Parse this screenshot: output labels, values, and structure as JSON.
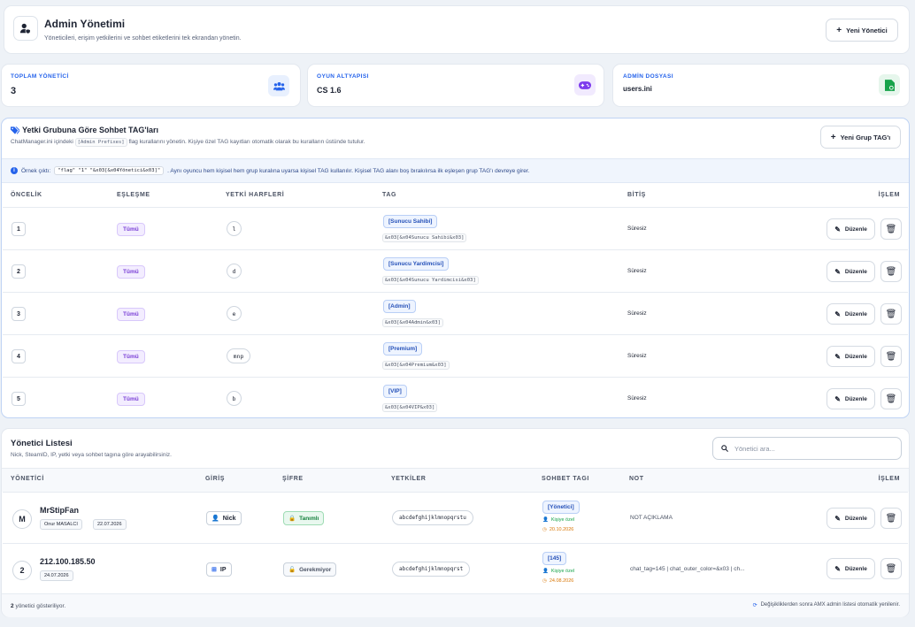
{
  "header": {
    "title": "Admin Yönetimi",
    "subtitle": "Yöneticileri, erişim yetkilerini ve sohbet etiketlerini tek ekrandan yönetin.",
    "new_button": "Yeni Yönetici"
  },
  "stats": [
    {
      "label": "TOPLAM YÖNETİCİ",
      "value": "3",
      "icon": "users-icon",
      "color": "#2563eb"
    },
    {
      "label": "OYUN ALTYAPISI",
      "value": "CS 1.6",
      "icon": "gamepad-icon",
      "color": "#7c3aed"
    },
    {
      "label": "ADMİN DOSYASI",
      "value": "users.ini",
      "icon": "file-icon",
      "color": "#16a34a"
    }
  ],
  "tags_section": {
    "title": "Yetki Grubuna Göre Sohbet TAG'ları",
    "desc_before": "ChatManager.ini içindeki",
    "desc_code": "[Admin Prefixes]",
    "desc_after": "flag kurallarını yönetin. Kişiye özel TAG kayıtları otomatik olarak bu kuralların üstünde tutulur.",
    "new_button": "Yeni Grup TAG'ı",
    "info_before": "Örnek çıktı:",
    "info_code": "\"flag\" \"1\" \"&x03[&x04Yönetici&x03]\"",
    "info_after": ". Aynı oyuncu hem kişisel hem grup kuralına uyarsa kişisel TAG kullanılır. Kişisel TAG alanı boş bırakılırsa ilk eşleşen grup TAG'ı devreye girer.",
    "columns": [
      "ÖNCELİK",
      "EŞLEŞME",
      "YETKİ HARFLERİ",
      "TAG",
      "BİTİŞ",
      "İŞLEM"
    ],
    "rows": [
      {
        "priority": "1",
        "match": "Tümü",
        "flags": "l",
        "tag": "[Sunucu Sahibi]",
        "code": "&x03[&x04Sunucu Sahibi&x03]",
        "end": "Süresiz",
        "edit": "Düzenle"
      },
      {
        "priority": "2",
        "match": "Tümü",
        "flags": "d",
        "tag": "[Sunucu Yardimcisi]",
        "code": "&x03[&x04Sunucu Yardimcisi&x03]",
        "end": "Süresiz",
        "edit": "Düzenle"
      },
      {
        "priority": "3",
        "match": "Tümü",
        "flags": "e",
        "tag": "[Admin]",
        "code": "&x03[&x04Admin&x03]",
        "end": "Süresiz",
        "edit": "Düzenle"
      },
      {
        "priority": "4",
        "match": "Tümü",
        "flags": "mnp",
        "tag": "[Premium]",
        "code": "&x03[&x04Premium&x03]",
        "end": "Süresiz",
        "edit": "Düzenle"
      },
      {
        "priority": "5",
        "match": "Tümü",
        "flags": "b",
        "tag": "[VIP]",
        "code": "&x03[&x04VIP&x03]",
        "end": "Süresiz",
        "edit": "Düzenle"
      }
    ]
  },
  "admins_section": {
    "title": "Yönetici Listesi",
    "desc": "Nick, SteamID, IP, yetki veya sohbet tagına göre arayabilirsiniz.",
    "search_placeholder": "Yönetici ara...",
    "columns": [
      "YÖNETİCİ",
      "GİRİŞ",
      "ŞİFRE",
      "YETKİLER",
      "SOHBET TAGI",
      "NOT",
      "İŞLEM"
    ],
    "rows": [
      {
        "avatar": "M",
        "name": "MrStipFan",
        "badge": "Onur MASALCI",
        "date": "22.07.2026",
        "login": "Nick",
        "password": "Tanımlı",
        "flags": "abcdefghijklmnopqrstu",
        "tag": "[Yönetici]",
        "tag_type": "Kişiye özel",
        "tag_date": "20.10.2026",
        "note": "NOT AÇIKLAMA",
        "edit": "Düzenle"
      },
      {
        "avatar": "2",
        "name": "212.100.185.50",
        "badge": "",
        "date": "24.07.2026",
        "login": "IP",
        "password": "Gerekmiyor",
        "flags": "abcdefghijklmnopqrst",
        "tag": "[145]",
        "tag_type": "Kişiye özel",
        "tag_date": "24.08.2026",
        "note": "chat_tag=145 | chat_outer_color=&x03 | ch...",
        "edit": "Düzenle"
      }
    ],
    "footer_count": "2",
    "footer_text": "yönetici gösteriliyor.",
    "footer_note": "Değişikliklerden sonra AMX admin listesi otomatik yenilenir."
  }
}
